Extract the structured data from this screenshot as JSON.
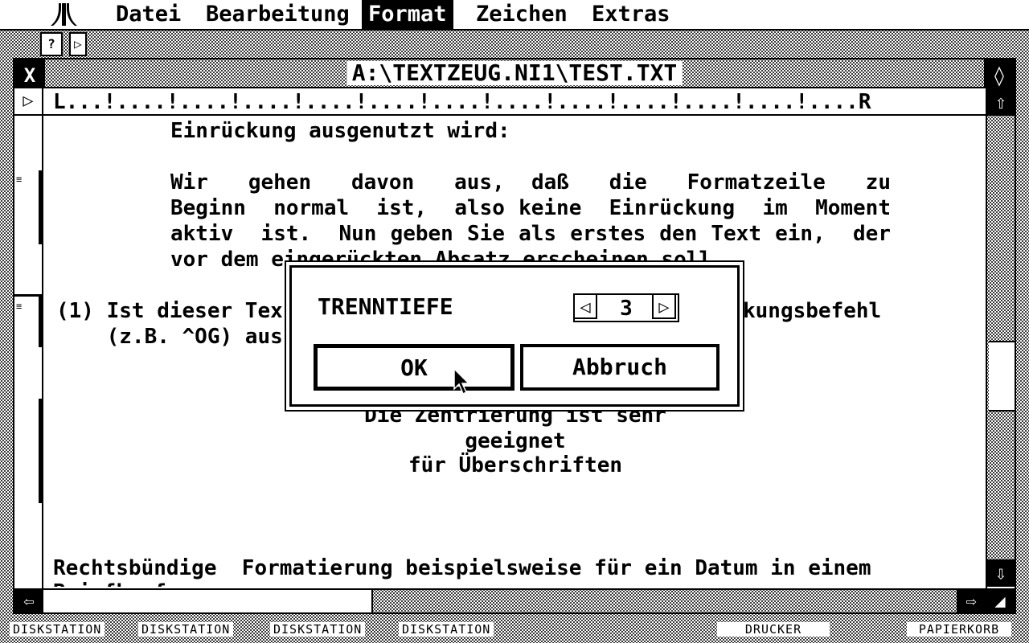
{
  "menubar": {
    "items": [
      "Datei",
      "Bearbeitung",
      "Format",
      "Zeichen",
      "Extras"
    ],
    "active": "Format"
  },
  "window": {
    "title": "A:\\TEXTZEUG.NI1\\TEST.TXT",
    "ruler": "L...!....!....!....!....!....!....!....!....!....!....!....!....R"
  },
  "document": {
    "l1": "Einrückung ausgenutzt wird:",
    "l2": "Wir   gehen   davon   aus,  daß   die   Formatzeile   zu",
    "l3": "Beginn  normal  ist,  also keine  Einrückung  im  Moment",
    "l4": "aktiv  ist.  Nun geben Sie als erstes den Text ein,  der",
    "l5": "vor dem eingerückten Absatz erscheinen soll.",
    "l6a": "(1) Ist dieser Tex",
    "l6b": "kungsbefehl",
    "l7": "    (z.B. ^OG) aus",
    "l8": "Die Zentrierung ist sehr",
    "l9": "geeignet",
    "l10": "für Überschriften",
    "l11": "Rechtsbündige  Formatierung beispielsweise für ein Datum in einem",
    "l12": "Briefkopf"
  },
  "dialog": {
    "label": "TRENNTIEFE",
    "value": "3",
    "ok_label": "OK",
    "cancel_label": "Abbruch"
  },
  "drives": {
    "d1": "DISKSTATION",
    "d2": "DISKSTATION",
    "d3": "DISKSTATION",
    "d4": "DISKSTATION",
    "printer": "DRUCKER",
    "trash": "PAPIERKORB"
  }
}
